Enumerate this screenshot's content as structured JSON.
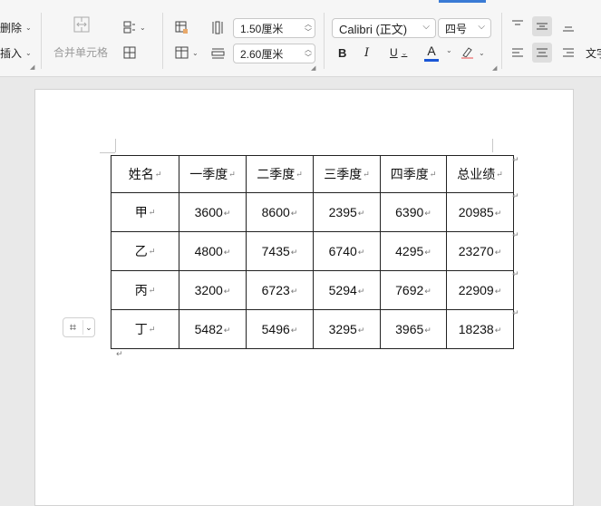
{
  "toolbar": {
    "delete_label": "删除",
    "insert_label": "插入",
    "merge_label": "合并单元格",
    "width_value": "1.50厘米",
    "height_value": "2.60厘米",
    "font_name": "Calibri (正文)",
    "font_size": "四号",
    "bold": "B",
    "italic": "I",
    "underline": "U",
    "font_color_glyph": "A",
    "text_direction_label": "文字"
  },
  "table": {
    "headers": [
      "姓名",
      "一季度",
      "二季度",
      "三季度",
      "四季度",
      "总业绩"
    ],
    "rows": [
      [
        "甲",
        "3600",
        "8600",
        "2395",
        "6390",
        "20985"
      ],
      [
        "乙",
        "4800",
        "7435",
        "6740",
        "4295",
        "23270"
      ],
      [
        "丙",
        "3200",
        "6723",
        "5294",
        "7692",
        "22909"
      ],
      [
        "丁",
        "5482",
        "5496",
        "3295",
        "3965",
        "18238"
      ]
    ]
  },
  "colors": {
    "accent": "#3a7bd5",
    "font_color_bar": "#1a56d6"
  },
  "icons": {
    "paragraph_mark": "↵",
    "row_end_mark": "↵"
  }
}
